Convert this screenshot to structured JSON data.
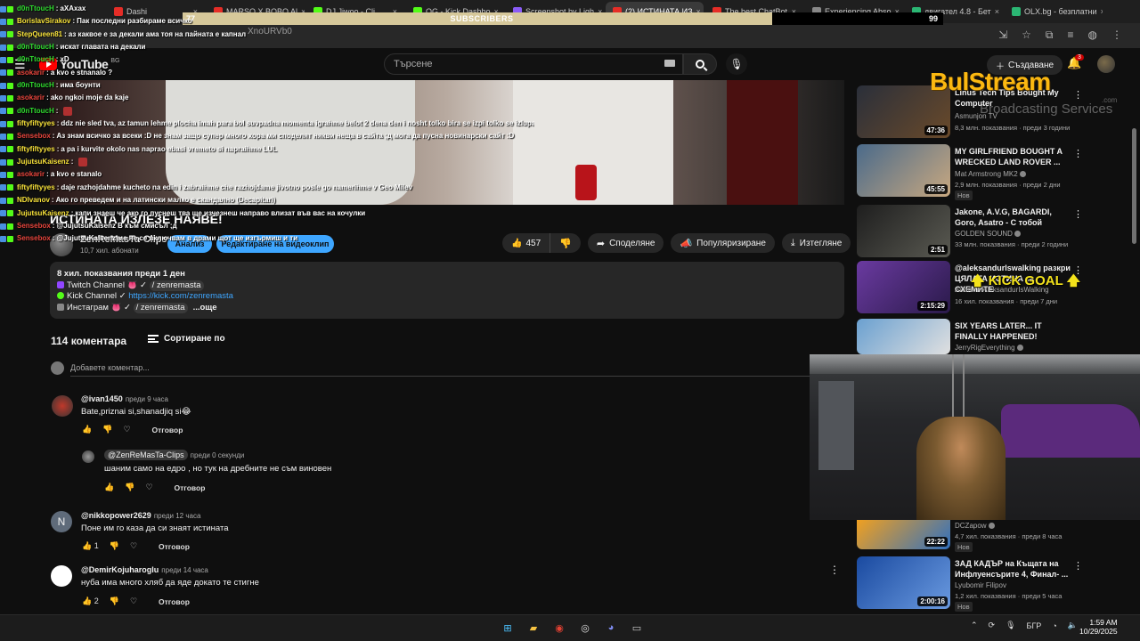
{
  "browser": {
    "tabs": [
      "Dashi",
      "MARSO X BOBO Al",
      "DJ Jiwoo - Cli",
      "OG - Kick Dashbo",
      "Screenshot by Ligh",
      "(2) ИСТИНАТА ИЗ",
      "The best ChatBot",
      "Experiencing Abso",
      "двигател 4.8 - Бет",
      "OLX.bg - безплатни"
    ],
    "url_fragment": "XnoURVb0",
    "subscribers_left": "77",
    "subscribers_label": "SUBSCRIBERS",
    "subscribers_right": "99"
  },
  "youtube": {
    "logo_text": "YouTube",
    "logo_country": "BG",
    "search_placeholder": "Търсене",
    "create_label": "Създаване",
    "notif_count": "3"
  },
  "video": {
    "title": "ИСТИНАТА ИЗЛЕЗЕ НАЯВЕ!",
    "channel_name": "ZenReMasTa-Clips",
    "channel_subs": "10,7 хил. абонати",
    "analysis_label": "Анализ",
    "edit_label": "Редактиране на видеоклип",
    "likes": "457",
    "share_label": "Споделяне",
    "promote_label": "Популяризиране",
    "download_label": "Изтегляне"
  },
  "description": {
    "meta": "8 хил. показвания  преди 1 ден",
    "line1_label": "Twitch Channel",
    "line1_chip": "/ zenremasta",
    "line2_label": "Kick Channel ✓",
    "line2_link": "https://kick.com/zenremasta",
    "line3_label": "Инстаграм",
    "line3_chip": "/ zenremasta",
    "more": "...още"
  },
  "comments": {
    "count": "114 коментара",
    "sort_label": "Сортиране по",
    "add_placeholder": "Добавете коментар...",
    "reply_label": "Отговор",
    "items": [
      {
        "user": "@ivan1450",
        "time": "преди 9 часа",
        "text": "Bate,priznai si,shanadjiq si😂",
        "likes": ""
      },
      {
        "user": "@ZenReMasTa-Clips",
        "time": "преди 0 секунди",
        "text": "шаним само на едро , но тук на дребните  не съм виновен",
        "likes": ""
      },
      {
        "user": "@nikkopower2629",
        "time": "преди 12 часа",
        "text": "Поне им го каза да си знаят истината",
        "likes": "1"
      },
      {
        "user": "@DemirKojuharoglu",
        "time": "преди 14 часа",
        "text": "нуба има много хляб да яде докато те стигне",
        "likes": "2"
      }
    ],
    "avatar_letter": "N"
  },
  "chat": [
    {
      "user": "d0nTtoucH",
      "color": "#2fdc2f",
      "msg": "aXAxax"
    },
    {
      "user": "BorislavSirakov",
      "color": "#f7e23a",
      "msg": "Пак последни разбираме всичко"
    },
    {
      "user": "StepQueen81",
      "color": "#f7e23a",
      "msg": "аз каквое е за декали ама тоя на пайната е капнал"
    },
    {
      "user": "d0nTtoucH",
      "color": "#2fdc2f",
      "msg": "искат главата на декали"
    },
    {
      "user": "d0nTtoucH",
      "color": "#2fdc2f",
      "msg": "xD"
    },
    {
      "user": "asokarir",
      "color": "#e8453c",
      "msg": "a kvo e stnanalo ?"
    },
    {
      "user": "d0nTtoucH",
      "color": "#2fdc2f",
      "msg": "има боунти"
    },
    {
      "user": "asokarir",
      "color": "#e8453c",
      "msg": "ako ngkoi moje da kaje"
    },
    {
      "user": "d0nTtoucH",
      "color": "#2fdc2f",
      "msg": ""
    },
    {
      "user": "fiftyfiftyyes",
      "color": "#f7e23a",
      "msg": "ddz nie sled tva, az tamun lehme plocha imah para bol suvpadna momenta igrahme belot 2 dena den i nosht tolko bira se izpi tolko se izlupa naprao ne se c"
    },
    {
      "user": "Sensebox",
      "color": "#e8453c",
      "msg": "Аз знам всичко за всеки :D не знам защо супер много хора ми споделят някви неща в сайта ;д мога да пусна новинарски сайт :D"
    },
    {
      "user": "fiftyfiftyyes",
      "color": "#f7e23a",
      "msg": "a pa i kurvite okolo nas naprao ebasi vremeto si napraihme LUL"
    },
    {
      "user": "JujutsuKaisenz",
      "color": "#f7e23a",
      "msg": ""
    },
    {
      "user": "asokarir",
      "color": "#e8453c",
      "msg": "a kvo e stanalo"
    },
    {
      "user": "fiftyfiftyyes",
      "color": "#f7e23a",
      "msg": "daje razhojdahme kucheto na edin i zabraihme che razhojdame jivotno posle go namerihme v Geo Milev"
    },
    {
      "user": "NDIvanov",
      "color": "#f7e23a",
      "msg": "Ако го преведем и на латински малко е скандално (Decapitari)"
    },
    {
      "user": "JujutsuKaisenz",
      "color": "#f7e23a",
      "msg": "капи знаеш че ако го пуснеш тва ще изчезнеш направо влизат във вас на кочулки"
    },
    {
      "user": "Sensebox",
      "color": "#e8453c",
      "msg": "@JujutsuKaisenz В към смисъл ;д"
    },
    {
      "user": "Sensebox",
      "color": "#e8453c",
      "msg": "@JujutsuKaisenz ме не се включвам в драми щот ще изгърмиш и ти"
    }
  ],
  "sidebar": [
    {
      "title": "Linus Tech Tips Bought My Computer",
      "channel": "Asmunjon TV",
      "meta": "8,3 млн. показвания · преди 3 години",
      "duration": "47:36",
      "new": ""
    },
    {
      "title": "MY GIRLFRIEND BOUGHT A WRECKED LAND ROVER ...",
      "channel": "Mat Armstrong MK2",
      "meta": "2,9 млн. показвания · преди 2 дни",
      "duration": "45:55",
      "new": "Нов"
    },
    {
      "title": "Jakone, A.V.G, BAGARDI, Goro, Asatro - С тобой",
      "channel": "GOLDEN SOUND",
      "meta": "33 млн. показвания · преди 2 години",
      "duration": "2:51",
      "new": ""
    },
    {
      "title": "@aleksandurlswalking разкри ЦЯЛАТА ИСТИНА за СХЕМИТЕ",
      "channel": "Айляк и AleksandurIsWalking",
      "meta": "16 хил. показвания · преди 7 дни",
      "duration": "2:15:29",
      "new": ""
    },
    {
      "title": "SIX YEARS LATER... IT FINALLY HAPPENED!",
      "channel": "JerryRigEverything",
      "meta": "",
      "duration": "",
      "new": ""
    },
    {
      "title": "",
      "channel": "DCZapow",
      "meta": "4,7 хил. показвания · преди 8 часа",
      "duration": "22:22",
      "new": "Нов"
    },
    {
      "title": "ЗАД КАДЪР на Къщата на Инфлуенсърите 4, Финал- ...",
      "channel": "Lyubomir Filipov",
      "meta": "1,2 хил. показвания · преди 5 часа",
      "duration": "2:00:16",
      "new": "Нов"
    }
  ],
  "overlay": {
    "brand": "BulStream",
    "brand_sub": "Broadcasting Services",
    "brand_com": ".com",
    "kick_goal": "KICK GOAL"
  },
  "taskbar": {
    "lang": "БГР",
    "time": "1:59 AM",
    "date": "10/29/2025"
  },
  "colors": {
    "accent_blue": "#3ea6ff",
    "youtube_red": "#ff0000",
    "brand_yellow": "#fbb811"
  }
}
